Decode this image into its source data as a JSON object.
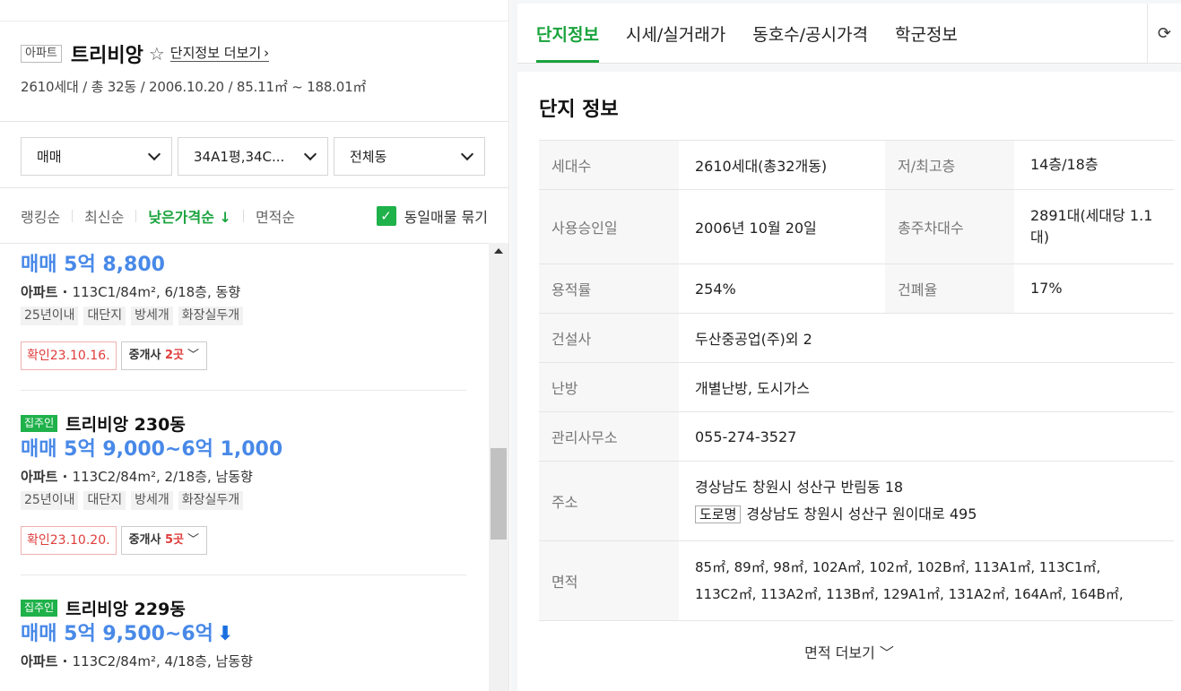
{
  "complex": {
    "type_tag": "아파트",
    "name": "트리비앙",
    "star": "☆",
    "more_label": "단지정보 더보기",
    "summary": "2610세대 / 총 32동 / 2006.10.20 / 85.11㎡ ~ 188.01㎡"
  },
  "filters": {
    "trade": "매매",
    "area": "34A1평,34C...",
    "dong": "전체동"
  },
  "sort": {
    "items": [
      "랭킹순",
      "최신순",
      "낮은가격순",
      "면적순"
    ],
    "active_suffix": "↓",
    "group_label": "동일매물 묶기"
  },
  "listings": [
    {
      "price": "매매 5억 8,800",
      "spec_prefix": "아파트 · ",
      "spec": "113C1/84m², 6/18층, 동향",
      "tags": [
        "25년이내",
        "대단지",
        "방세개",
        "화장실두개"
      ],
      "confirm": "확인23.10.16.",
      "broker_label": "중개사",
      "broker_count": "2곳"
    },
    {
      "owner_tag": "집주인",
      "building": "트리비앙 230동",
      "price": "매매 5억 9,000~6억 1,000",
      "spec_prefix": "아파트 · ",
      "spec": "113C2/84m², 2/18층, 남동향",
      "tags": [
        "25년이내",
        "대단지",
        "방세개",
        "화장실두개"
      ],
      "confirm": "확인23.10.20.",
      "broker_label": "중개사",
      "broker_count": "5곳"
    },
    {
      "owner_tag": "집주인",
      "building": "트리비앙 229동",
      "price": "매매 5억 9,500~6억",
      "spec_prefix": "아파트 · ",
      "spec": "113C2/84m², 4/18층, 남동향"
    }
  ],
  "tabs": [
    "단지정보",
    "시세/실거래가",
    "동호수/공시가격",
    "학군정보"
  ],
  "info": {
    "title": "단지 정보",
    "households_k": "세대수",
    "households_v": "2610세대(총32개동)",
    "floors_k": "저/최고층",
    "floors_v": "14층/18층",
    "approval_k": "사용승인일",
    "approval_v": "2006년 10월 20일",
    "parking_k": "총주차대수",
    "parking_v": "2891대(세대당 1.1대)",
    "far_k": "용적률",
    "far_v": "254%",
    "bcr_k": "건폐율",
    "bcr_v": "17%",
    "builder_k": "건설사",
    "builder_v": "두산중공업(주)외 2",
    "heating_k": "난방",
    "heating_v": "개별난방, 도시가스",
    "office_k": "관리사무소",
    "office_v": "055-274-3527",
    "address_k": "주소",
    "address_v": "경상남도 창원시 성산구 반림동 18",
    "road_tag": "도로명",
    "road_v": "경상남도 창원시 성산구 원이대로 495",
    "area_k": "면적",
    "area_v1": "85㎡, 89㎡, 98㎡, 102A㎡, 102㎡, 102B㎡, 113A1㎡, 113C1㎡,",
    "area_v2": "113C2㎡, 113A2㎡, 113B㎡, 129A1㎡, 131A2㎡, 164A㎡, 164B㎡,",
    "area_more": "면적 더보기"
  }
}
